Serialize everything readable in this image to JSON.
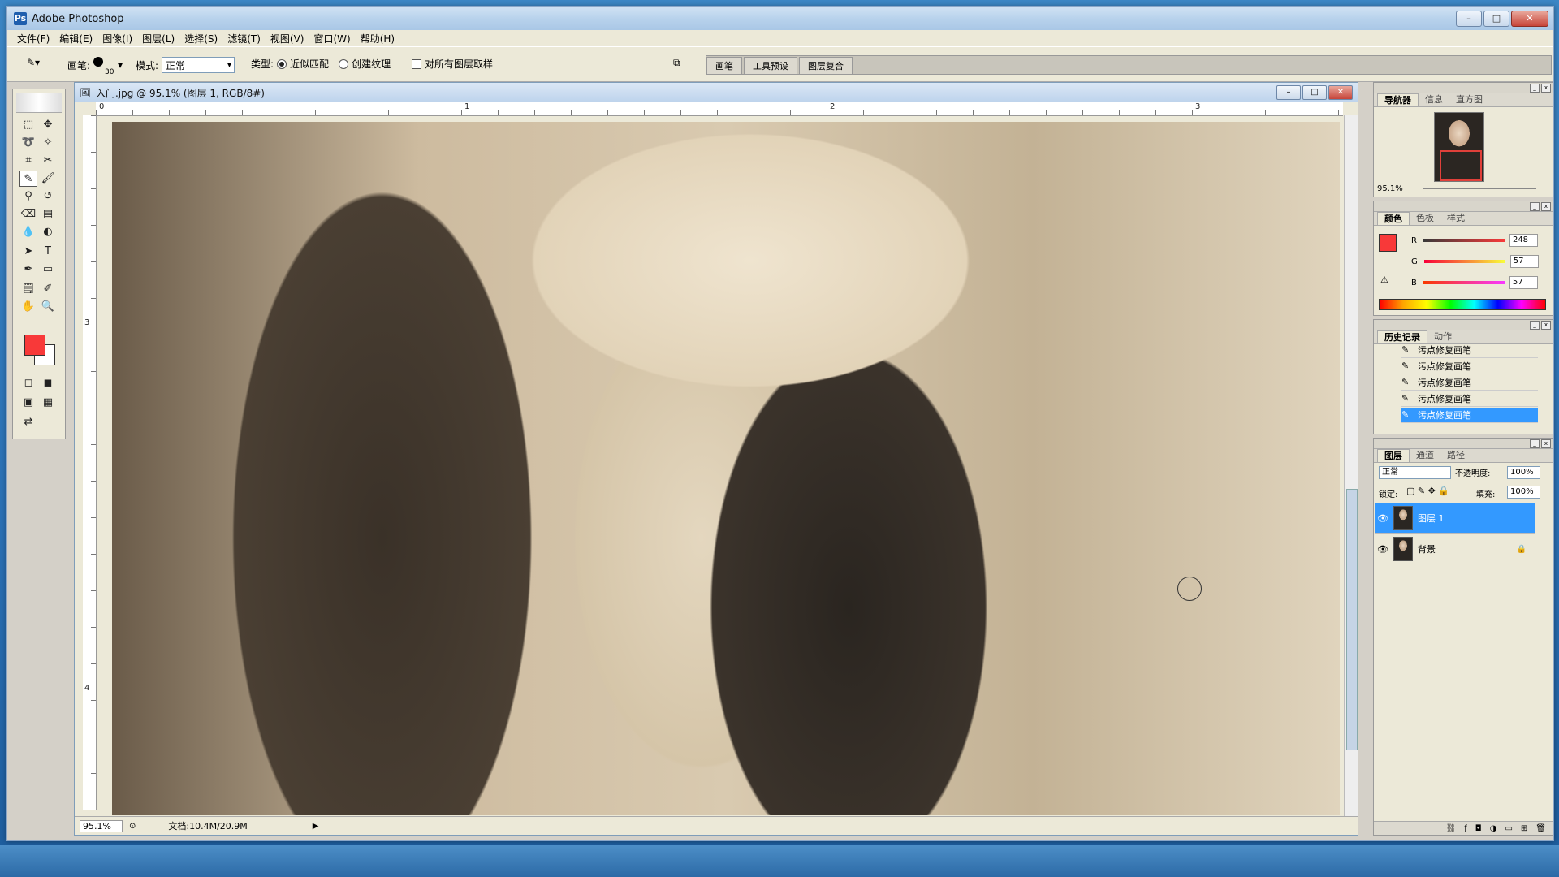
{
  "app": {
    "title": "Adobe Photoshop"
  },
  "menu": [
    "文件(F)",
    "编辑(E)",
    "图像(I)",
    "图层(L)",
    "选择(S)",
    "滤镜(T)",
    "视图(V)",
    "窗口(W)",
    "帮助(H)"
  ],
  "options": {
    "brush_label": "画笔:",
    "brush_size": "30",
    "mode_label": "模式:",
    "mode_value": "正常",
    "type_label": "类型:",
    "type_option1": "近似匹配",
    "type_option2": "创建纹理",
    "sample_all_layers": "对所有图层取样",
    "well_tabs": [
      "画笔",
      "工具预设",
      "图层复合"
    ]
  },
  "document": {
    "title": "入门.jpg @ 95.1% (图层 1, RGB/8#)",
    "zoom": "95.1%",
    "doc_size": "文档:10.4M/20.9M",
    "ruler_h": [
      "0",
      "1",
      "2",
      "3"
    ],
    "ruler_v": [
      "3",
      "4"
    ]
  },
  "panels": {
    "navigator": {
      "tabs": [
        "导航器",
        "信息",
        "直方图"
      ],
      "zoom": "95.1%"
    },
    "color": {
      "tabs": [
        "颜色",
        "色板",
        "样式"
      ],
      "r_label": "R",
      "r": "248",
      "g_label": "G",
      "g": "57",
      "b_label": "B",
      "b": "57",
      "fg_color": "#f83939"
    },
    "history": {
      "tabs": [
        "历史记录",
        "动作"
      ],
      "items": [
        "污点修复画笔",
        "污点修复画笔",
        "污点修复画笔",
        "污点修复画笔",
        "污点修复画笔"
      ]
    },
    "layers": {
      "tabs": [
        "图层",
        "通道",
        "路径"
      ],
      "blend": "正常",
      "opacity_label": "不透明度:",
      "opacity": "100%",
      "lock_label": "锁定:",
      "fill_label": "填充:",
      "fill": "100%",
      "layers": [
        "图层 1",
        "背景"
      ]
    }
  }
}
